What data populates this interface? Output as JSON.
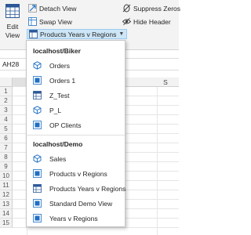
{
  "ribbon": {
    "edit_view_label": "Edit View",
    "detach_view": "Detach View",
    "swap_view": "Swap View",
    "current_view": "Products Years v Regions",
    "suppress_zeros": "Suppress Zeros",
    "hide_header": "Hide Header"
  },
  "formula_bar": {
    "name_box": "AH28"
  },
  "sheet": {
    "selected_column": "",
    "column_header_right": "S",
    "row_numbers": [
      "1",
      "2",
      "3",
      "4",
      "5",
      "6",
      "7",
      "8",
      "9",
      "10",
      "11",
      "12",
      "13",
      "14",
      "15"
    ]
  },
  "menu": {
    "groups": [
      {
        "title": "localhost/Biker",
        "items": [
          {
            "label": "Orders",
            "icon": "cube-icon"
          },
          {
            "label": "Orders 1",
            "icon": "view-icon"
          },
          {
            "label": "Z_Test",
            "icon": "grid-icon"
          },
          {
            "label": "P_L",
            "icon": "cube-icon"
          },
          {
            "label": "OP Clients",
            "icon": "view-icon"
          }
        ]
      },
      {
        "title": "localhost/Demo",
        "items": [
          {
            "label": "Sales",
            "icon": "cube-icon"
          },
          {
            "label": "Products  v Regions",
            "icon": "view-icon"
          },
          {
            "label": "Products Years v Regions",
            "icon": "grid-icon"
          },
          {
            "label": "Standard Demo View",
            "icon": "view-icon"
          },
          {
            "label": "Years v Regions",
            "icon": "view-icon"
          }
        ]
      }
    ]
  },
  "colors": {
    "accent": "#1f6fc5",
    "selected_bg": "#cde6f7"
  }
}
